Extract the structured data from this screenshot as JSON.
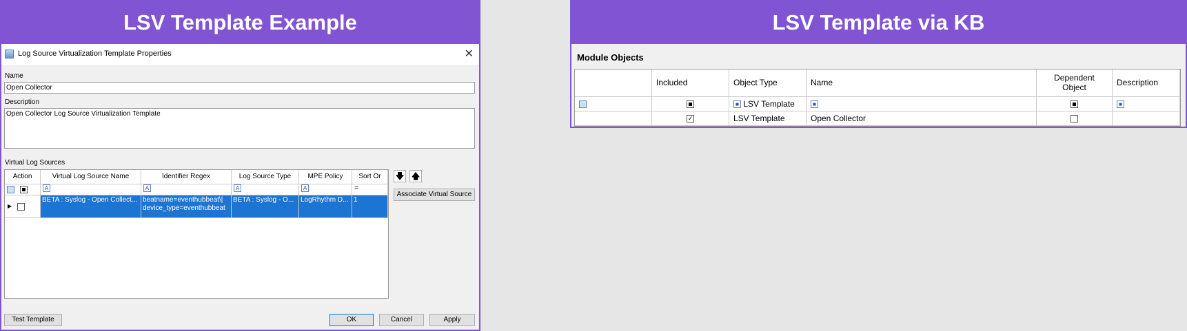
{
  "left": {
    "banner": "LSV Template Example",
    "dialog": {
      "title": "Log Source Virtualization Template Properties",
      "close_glyph": "✕",
      "name_label": "Name",
      "name_value": "Open Collector",
      "description_label": "Description",
      "description_value": "Open Collector Log Source Virtualization Template",
      "vls_label": "Virtual Log Sources",
      "columns": [
        "Action",
        "Virtual Log Source Name",
        "Identifier Regex",
        "Log Source Type",
        "MPE Policy",
        "Sort Or"
      ],
      "filter_symbols": [
        "A",
        "A",
        "A",
        "A",
        "="
      ],
      "selected_row": {
        "vls_name": "BETA : Syslog - Open Collect...",
        "regex_line1": "beatname=eventhubbeat\\|",
        "regex_line2": "device_type=eventhubbeat",
        "log_source_type": "BETA : Syslog - O...",
        "mpe_policy": "LogRhythm  D...",
        "sort_order": "1"
      },
      "associate_button": "Associate Virtual Source",
      "move_down_glyph": "🡇",
      "move_up_glyph": "🡅",
      "test_button": "Test Template",
      "ok_button": "OK",
      "cancel_button": "Cancel",
      "apply_button": "Apply"
    }
  },
  "right": {
    "banner": "LSV Template via KB",
    "module_title": "Module Objects",
    "columns": {
      "included": "Included",
      "object_type": "Object Type",
      "name": "Name",
      "dependent_line1": "Dependent",
      "dependent_line2": "Object",
      "description": "Description"
    },
    "filter_row": {
      "object_type": "LSV Template"
    },
    "rows": [
      {
        "included": true,
        "object_type": "LSV Template",
        "name": "Open Collector",
        "dependent": false,
        "description": ""
      }
    ]
  }
}
